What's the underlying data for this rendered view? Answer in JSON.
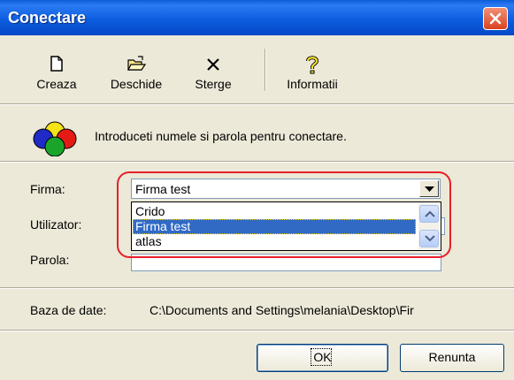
{
  "window": {
    "title": "Conectare"
  },
  "toolbar": {
    "items": [
      {
        "label": "Creaza",
        "icon": "new-document-icon"
      },
      {
        "label": "Deschide",
        "icon": "open-folder-icon"
      },
      {
        "label": "Sterge",
        "icon": "delete-x-icon"
      },
      {
        "label": "Informatii",
        "icon": "help-question-icon"
      }
    ]
  },
  "intro": {
    "text": "Introduceti numele si parola pentru conectare.",
    "icon": "four-color-circles-icon"
  },
  "form": {
    "firma_label": "Firma:",
    "firma_value": "Firma test",
    "dropdown_options": [
      "Crido",
      "Firma test",
      "atlas"
    ],
    "selected_option": "Firma test",
    "utilizator_label": "Utilizator:",
    "parola_label": "Parola:"
  },
  "database": {
    "label": "Baza de date:",
    "path": "C:\\Documents and Settings\\melania\\Desktop\\Fir"
  },
  "buttons": {
    "ok": "OK",
    "cancel": "Renunta"
  },
  "colors": {
    "title_bar": "#0a5cd8",
    "selection": "#316ac5",
    "highlight_outline": "#e8202a",
    "dialog_bg": "#ece9d8"
  }
}
